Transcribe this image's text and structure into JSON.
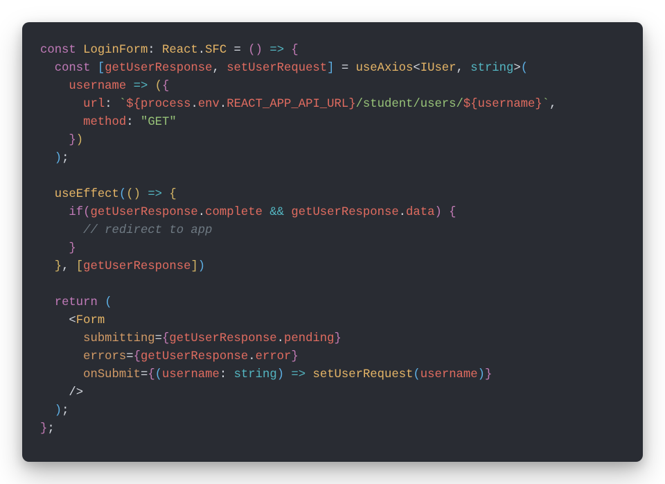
{
  "code": {
    "lines": [
      [
        {
          "t": "const ",
          "c": "kw"
        },
        {
          "t": "LoginForm",
          "c": "fn"
        },
        {
          "t": ": ",
          "c": "pn"
        },
        {
          "t": "React",
          "c": "fn"
        },
        {
          "t": ".",
          "c": "pn"
        },
        {
          "t": "SFC",
          "c": "fn"
        },
        {
          "t": " = ",
          "c": "pn"
        },
        {
          "t": "(",
          "c": "br"
        },
        {
          "t": ")",
          "c": "br"
        },
        {
          "t": " => ",
          "c": "op"
        },
        {
          "t": "{",
          "c": "br"
        }
      ],
      [
        {
          "t": "  ",
          "c": "pn"
        },
        {
          "t": "const ",
          "c": "kw"
        },
        {
          "t": "[",
          "c": "br2"
        },
        {
          "t": "getUserResponse",
          "c": "id"
        },
        {
          "t": ", ",
          "c": "pn"
        },
        {
          "t": "setUserRequest",
          "c": "id"
        },
        {
          "t": "]",
          "c": "br2"
        },
        {
          "t": " = ",
          "c": "pn"
        },
        {
          "t": "useAxios",
          "c": "fn"
        },
        {
          "t": "<",
          "c": "pn"
        },
        {
          "t": "IUser",
          "c": "fn"
        },
        {
          "t": ", ",
          "c": "pn"
        },
        {
          "t": "string",
          "c": "typ"
        },
        {
          "t": ">",
          "c": "pn"
        },
        {
          "t": "(",
          "c": "br2"
        }
      ],
      [
        {
          "t": "    ",
          "c": "pn"
        },
        {
          "t": "username",
          "c": "id"
        },
        {
          "t": " => ",
          "c": "op"
        },
        {
          "t": "(",
          "c": "bry"
        },
        {
          "t": "{",
          "c": "br"
        }
      ],
      [
        {
          "t": "      ",
          "c": "pn"
        },
        {
          "t": "url",
          "c": "id"
        },
        {
          "t": ": ",
          "c": "pn"
        },
        {
          "t": "`",
          "c": "str"
        },
        {
          "t": "${",
          "c": "tmpl"
        },
        {
          "t": "process",
          "c": "id"
        },
        {
          "t": ".",
          "c": "pn"
        },
        {
          "t": "env",
          "c": "id"
        },
        {
          "t": ".",
          "c": "pn"
        },
        {
          "t": "REACT_APP_API_URL",
          "c": "id"
        },
        {
          "t": "}",
          "c": "tmpl"
        },
        {
          "t": "/student/users/",
          "c": "str"
        },
        {
          "t": "${",
          "c": "tmpl"
        },
        {
          "t": "username",
          "c": "id"
        },
        {
          "t": "}",
          "c": "tmpl"
        },
        {
          "t": "`",
          "c": "str"
        },
        {
          "t": ",",
          "c": "pn"
        }
      ],
      [
        {
          "t": "      ",
          "c": "pn"
        },
        {
          "t": "method",
          "c": "id"
        },
        {
          "t": ": ",
          "c": "pn"
        },
        {
          "t": "\"GET\"",
          "c": "str"
        }
      ],
      [
        {
          "t": "    ",
          "c": "pn"
        },
        {
          "t": "}",
          "c": "br"
        },
        {
          "t": ")",
          "c": "bry"
        }
      ],
      [
        {
          "t": "  ",
          "c": "pn"
        },
        {
          "t": ")",
          "c": "br2"
        },
        {
          "t": ";",
          "c": "pn"
        }
      ],
      [
        {
          "t": "",
          "c": "pn"
        }
      ],
      [
        {
          "t": "  ",
          "c": "pn"
        },
        {
          "t": "useEffect",
          "c": "fn"
        },
        {
          "t": "(",
          "c": "br2"
        },
        {
          "t": "(",
          "c": "bry"
        },
        {
          "t": ")",
          "c": "bry"
        },
        {
          "t": " => ",
          "c": "op"
        },
        {
          "t": "{",
          "c": "bry"
        }
      ],
      [
        {
          "t": "    ",
          "c": "pn"
        },
        {
          "t": "if",
          "c": "kw"
        },
        {
          "t": "(",
          "c": "br"
        },
        {
          "t": "getUserResponse",
          "c": "id"
        },
        {
          "t": ".",
          "c": "pn"
        },
        {
          "t": "complete",
          "c": "id"
        },
        {
          "t": " && ",
          "c": "op"
        },
        {
          "t": "getUserResponse",
          "c": "id"
        },
        {
          "t": ".",
          "c": "pn"
        },
        {
          "t": "data",
          "c": "id"
        },
        {
          "t": ")",
          "c": "br"
        },
        {
          "t": " {",
          "c": "br"
        }
      ],
      [
        {
          "t": "      ",
          "c": "pn"
        },
        {
          "t": "// redirect to app",
          "c": "cmt"
        }
      ],
      [
        {
          "t": "    ",
          "c": "pn"
        },
        {
          "t": "}",
          "c": "br"
        }
      ],
      [
        {
          "t": "  ",
          "c": "pn"
        },
        {
          "t": "}",
          "c": "bry"
        },
        {
          "t": ", ",
          "c": "pn"
        },
        {
          "t": "[",
          "c": "bry"
        },
        {
          "t": "getUserResponse",
          "c": "id"
        },
        {
          "t": "]",
          "c": "bry"
        },
        {
          "t": ")",
          "c": "br2"
        }
      ],
      [
        {
          "t": "",
          "c": "pn"
        }
      ],
      [
        {
          "t": "  ",
          "c": "pn"
        },
        {
          "t": "return ",
          "c": "kw"
        },
        {
          "t": "(",
          "c": "br2"
        }
      ],
      [
        {
          "t": "    ",
          "c": "pn"
        },
        {
          "t": "<",
          "c": "pn"
        },
        {
          "t": "Form",
          "c": "tag"
        }
      ],
      [
        {
          "t": "      ",
          "c": "pn"
        },
        {
          "t": "submitting",
          "c": "attr"
        },
        {
          "t": "=",
          "c": "pn"
        },
        {
          "t": "{",
          "c": "br"
        },
        {
          "t": "getUserResponse",
          "c": "id"
        },
        {
          "t": ".",
          "c": "pn"
        },
        {
          "t": "pending",
          "c": "id"
        },
        {
          "t": "}",
          "c": "br"
        }
      ],
      [
        {
          "t": "      ",
          "c": "pn"
        },
        {
          "t": "errors",
          "c": "attr"
        },
        {
          "t": "=",
          "c": "pn"
        },
        {
          "t": "{",
          "c": "br"
        },
        {
          "t": "getUserResponse",
          "c": "id"
        },
        {
          "t": ".",
          "c": "pn"
        },
        {
          "t": "error",
          "c": "id"
        },
        {
          "t": "}",
          "c": "br"
        }
      ],
      [
        {
          "t": "      ",
          "c": "pn"
        },
        {
          "t": "onSubmit",
          "c": "attr"
        },
        {
          "t": "=",
          "c": "pn"
        },
        {
          "t": "{",
          "c": "br"
        },
        {
          "t": "(",
          "c": "br2"
        },
        {
          "t": "username",
          "c": "id"
        },
        {
          "t": ": ",
          "c": "pn"
        },
        {
          "t": "string",
          "c": "typ"
        },
        {
          "t": ")",
          "c": "br2"
        },
        {
          "t": " => ",
          "c": "op"
        },
        {
          "t": "setUserRequest",
          "c": "fn"
        },
        {
          "t": "(",
          "c": "br2"
        },
        {
          "t": "username",
          "c": "id"
        },
        {
          "t": ")",
          "c": "br2"
        },
        {
          "t": "}",
          "c": "br"
        }
      ],
      [
        {
          "t": "    ",
          "c": "pn"
        },
        {
          "t": "/>",
          "c": "pn"
        }
      ],
      [
        {
          "t": "  ",
          "c": "pn"
        },
        {
          "t": ")",
          "c": "br2"
        },
        {
          "t": ";",
          "c": "pn"
        }
      ],
      [
        {
          "t": "}",
          "c": "br"
        },
        {
          "t": ";",
          "c": "pn"
        }
      ]
    ]
  }
}
